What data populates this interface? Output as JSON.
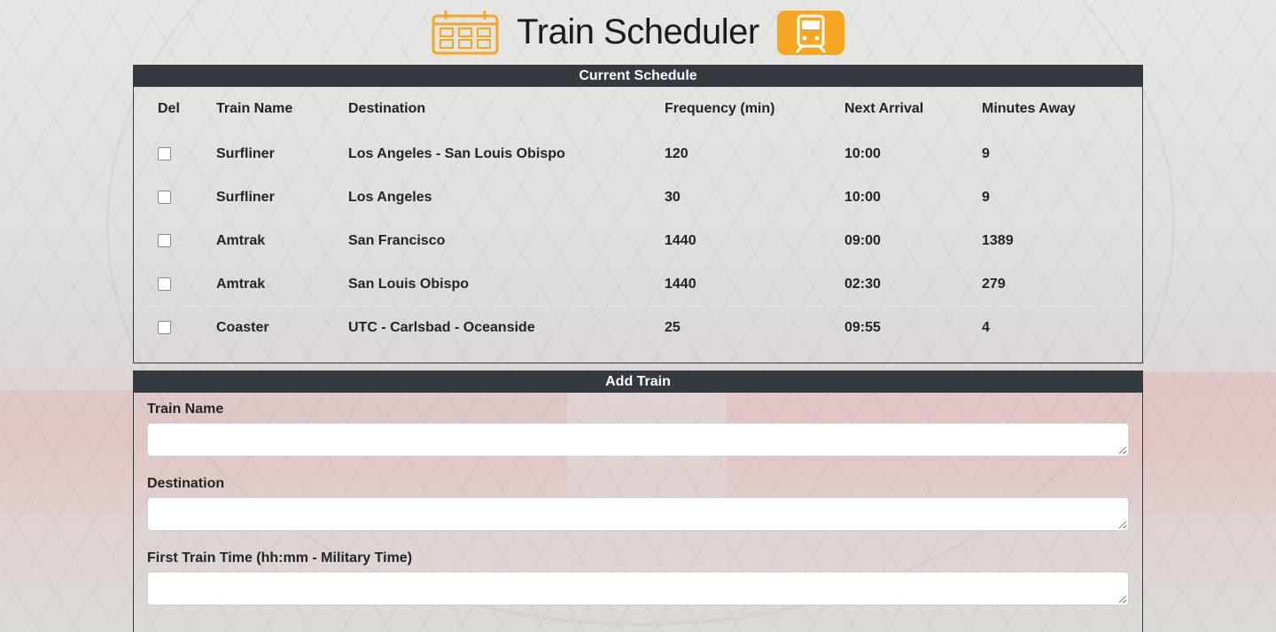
{
  "header": {
    "title": "Train Scheduler",
    "left_icon": "calendar-icon",
    "right_icon": "train-icon",
    "accent_color": "#f5a623"
  },
  "schedule": {
    "heading": "Current Schedule",
    "columns": [
      "Del",
      "Train Name",
      "Destination",
      "Frequency (min)",
      "Next Arrival",
      "Minutes Away"
    ],
    "rows": [
      {
        "name": "Surfliner",
        "destination": "Los Angeles - San Louis Obispo",
        "frequency": "120",
        "next_arrival": "10:00",
        "minutes_away": "9"
      },
      {
        "name": "Surfliner",
        "destination": "Los Angeles",
        "frequency": "30",
        "next_arrival": "10:00",
        "minutes_away": "9"
      },
      {
        "name": "Amtrak",
        "destination": "San Francisco",
        "frequency": "1440",
        "next_arrival": "09:00",
        "minutes_away": "1389"
      },
      {
        "name": "Amtrak",
        "destination": "San Louis Obispo",
        "frequency": "1440",
        "next_arrival": "02:30",
        "minutes_away": "279"
      },
      {
        "name": "Coaster",
        "destination": "UTC - Carlsbad - Oceanside",
        "frequency": "25",
        "next_arrival": "09:55",
        "minutes_away": "4"
      }
    ]
  },
  "add_train": {
    "heading": "Add Train",
    "fields": [
      {
        "label": "Train Name",
        "value": ""
      },
      {
        "label": "Destination",
        "value": ""
      },
      {
        "label": "First Train Time (hh:mm - Military Time)",
        "value": ""
      }
    ]
  }
}
